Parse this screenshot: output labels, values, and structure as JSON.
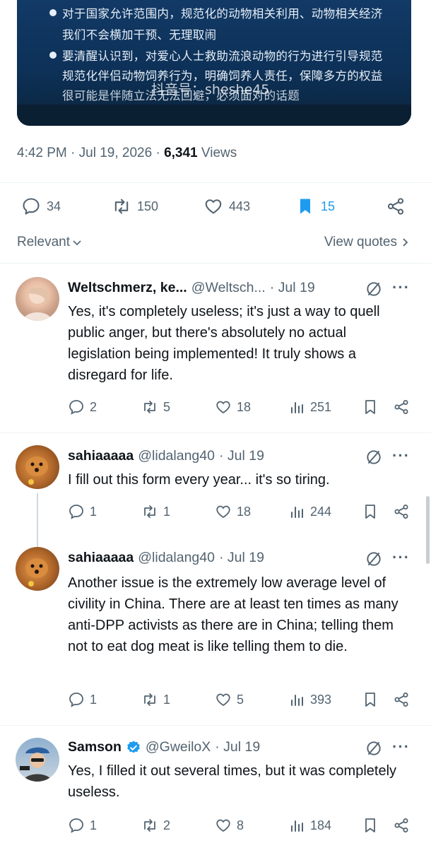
{
  "media": {
    "lines": [
      "对于国家允许范围内，规范化的动物相关利用、动物相关经济",
      "我们不会横加干预、无理取闹",
      "要清醒认识到，对爱心人士救助流浪动物的行为进行引导规范",
      "规范化伴侣动物饲养行为，明确饲养人责任，保障多方的权益",
      "很可能是伴随立法无法回避，必须面对的话题"
    ],
    "watermark": "抖音号：sheshe45"
  },
  "tweet_meta": {
    "time": "4:42 PM",
    "date": "Jul 19, 2026",
    "views_count": "6,341",
    "views_label": "Views"
  },
  "actions": {
    "replies": "34",
    "reposts": "150",
    "likes": "443",
    "bookmarks": "15"
  },
  "sort": {
    "label": "Relevant",
    "view_quotes": "View quotes"
  },
  "colors": {
    "accent": "#1d9bf0",
    "muted": "#536471",
    "text": "#0f1419"
  },
  "replies": [
    {
      "name": "Weltschmerz, ke...",
      "handle": "@Weltsch...",
      "date": "· Jul 19",
      "verified": false,
      "text": "Yes, it's completely useless; it's just a way to quell public anger, but there's absolutely no actual legislation being implemented! It truly shows a disregard for life.",
      "replies": "2",
      "reposts": "5",
      "likes": "18",
      "views": "251"
    },
    {
      "name": "sahiaaaaa",
      "handle": "@lidalang40",
      "date": "· Jul 19",
      "verified": false,
      "text": "I fill out this form every year... it's so tiring.",
      "replies": "1",
      "reposts": "1",
      "likes": "18",
      "views": "244"
    },
    {
      "name": "sahiaaaaa",
      "handle": "@lidalang40",
      "date": "· Jul 19",
      "verified": false,
      "text": "Another issue is the extremely low average level of civility in China. There are at least ten times as many anti-DPP activists as there are in China; telling them not to eat dog meat is like telling them to die.",
      "replies": "1",
      "reposts": "1",
      "likes": "5",
      "views": "393"
    },
    {
      "name": "Samson",
      "handle": "@GweiloX",
      "date": "· Jul 19",
      "verified": true,
      "text": "Yes, I filled it out several times, but it was completely useless.",
      "replies": "1",
      "reposts": "2",
      "likes": "8",
      "views": "184"
    }
  ]
}
